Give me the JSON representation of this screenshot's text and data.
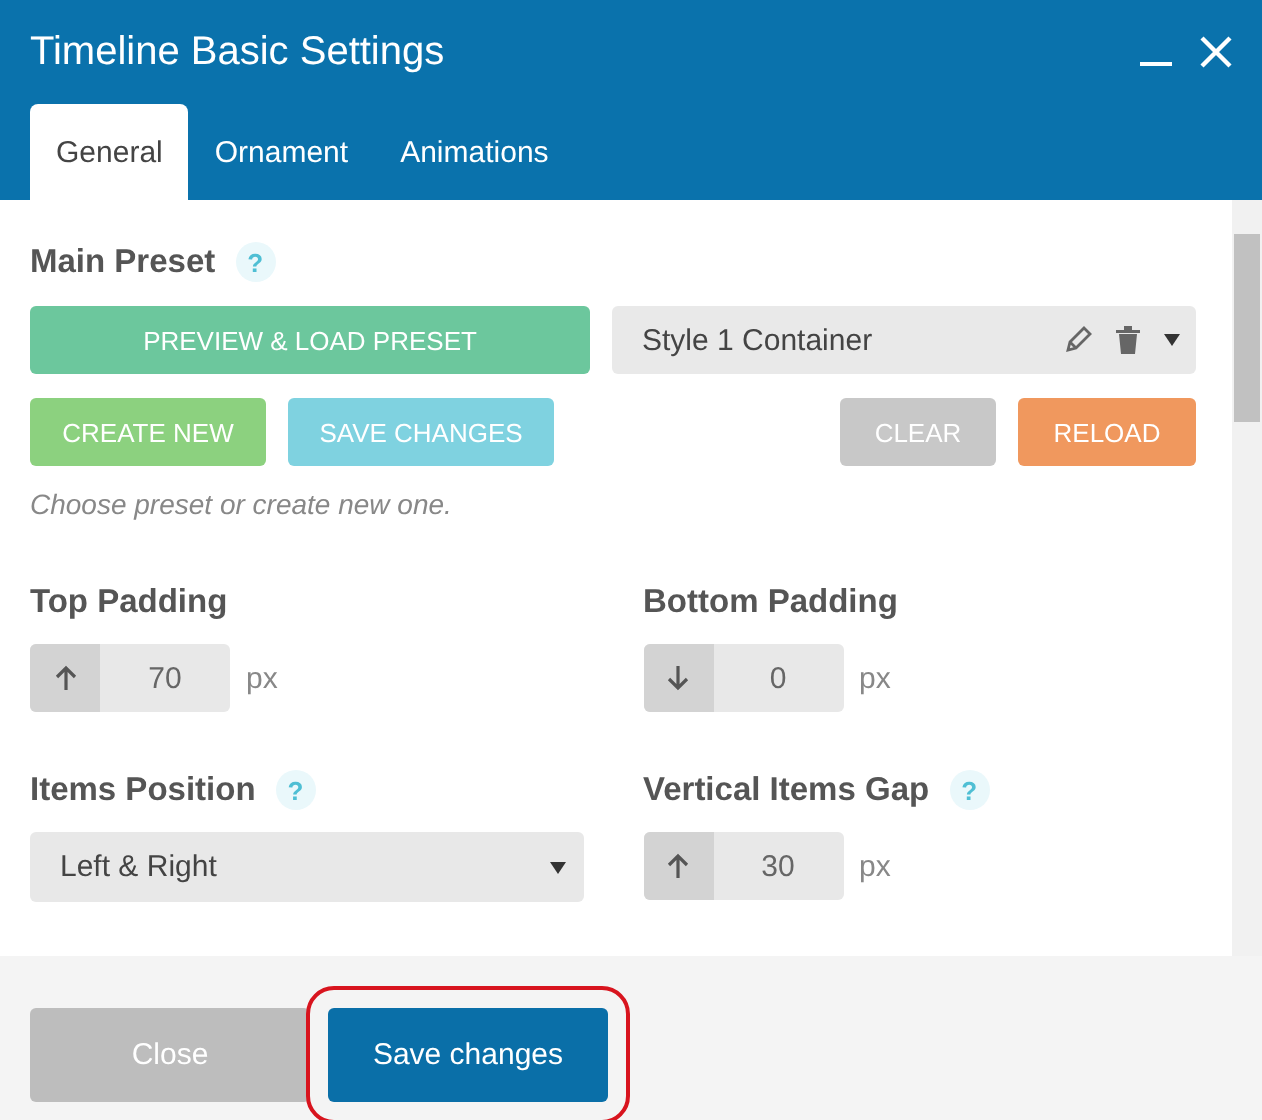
{
  "window": {
    "title": "Timeline Basic Settings"
  },
  "tabs": [
    {
      "label": "General",
      "selected": true
    },
    {
      "label": "Ornament",
      "selected": false
    },
    {
      "label": "Animations",
      "selected": false
    }
  ],
  "main_preset": {
    "label": "Main Preset",
    "help": "?",
    "preview_button": "PREVIEW & LOAD PRESET",
    "preset_select": {
      "value": "Style 1 Container"
    },
    "buttons": [
      {
        "label": "CREATE NEW",
        "kind": "create"
      },
      {
        "label": "SAVE CHANGES",
        "kind": "save"
      },
      {
        "label": "CLEAR",
        "kind": "clear"
      },
      {
        "label": "RELOAD",
        "kind": "reload"
      }
    ],
    "hint": "Choose preset or create new one."
  },
  "fields": [
    {
      "kind": "number",
      "label": "Top Padding",
      "stepper": {
        "kind": "up"
      },
      "value": "70",
      "unit": "px"
    },
    {
      "kind": "number",
      "label": "Bottom Padding",
      "stepper": {
        "kind": "down"
      },
      "value": "0",
      "unit": "px"
    },
    {
      "kind": "select",
      "label": "Items Position",
      "help": "?",
      "value": "Left & Right"
    },
    {
      "kind": "number",
      "label": "Vertical Items Gap",
      "help": "?",
      "stepper": {
        "kind": "up"
      },
      "value": "30",
      "unit": "px"
    }
  ],
  "footer": {
    "buttons": [
      {
        "label": "Close",
        "kind": "close",
        "highlighted": false
      },
      {
        "label": "Save changes",
        "kind": "primary",
        "highlighted": true
      }
    ]
  }
}
